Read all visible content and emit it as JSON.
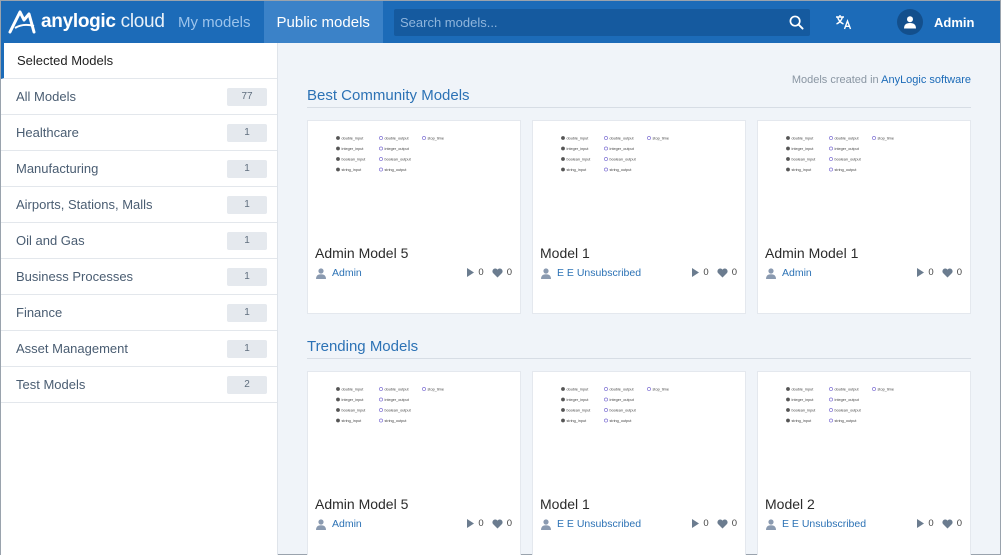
{
  "header": {
    "logo_bold": "anylogic",
    "logo_light": " cloud",
    "nav": [
      {
        "label": "My models",
        "active": false
      },
      {
        "label": "Public models",
        "active": true
      }
    ],
    "search": {
      "placeholder": "Search models..."
    },
    "user": {
      "name": "Admin"
    }
  },
  "sidebar": {
    "items": [
      {
        "label": "Selected Models",
        "count": null,
        "selected": true
      },
      {
        "label": "All Models",
        "count": "77"
      },
      {
        "label": "Healthcare",
        "count": "1"
      },
      {
        "label": "Manufacturing",
        "count": "1"
      },
      {
        "label": "Airports, Stations, Malls",
        "count": "1"
      },
      {
        "label": "Oil and Gas",
        "count": "1"
      },
      {
        "label": "Business Processes",
        "count": "1"
      },
      {
        "label": "Finance",
        "count": "1"
      },
      {
        "label": "Asset Management",
        "count": "1"
      },
      {
        "label": "Test Models",
        "count": "2"
      }
    ]
  },
  "main": {
    "note_prefix": "Models created in ",
    "note_link": "AnyLogic software",
    "sections": [
      {
        "title": "Best Community Models",
        "cards": [
          {
            "title": "Admin Model 5",
            "author": "Admin",
            "runs": "0",
            "likes": "0"
          },
          {
            "title": "Model 1",
            "author": "E E Unsubscribed",
            "runs": "0",
            "likes": "0"
          },
          {
            "title": "Admin Model 1",
            "author": "Admin",
            "runs": "0",
            "likes": "0"
          }
        ]
      },
      {
        "title": "Trending Models",
        "cards": [
          {
            "title": "Admin Model 5",
            "author": "Admin",
            "runs": "0",
            "likes": "0"
          },
          {
            "title": "Model 1",
            "author": "E E Unsubscribed",
            "runs": "0",
            "likes": "0"
          },
          {
            "title": "Model 2",
            "author": "E E Unsubscribed",
            "runs": "0",
            "likes": "0"
          }
        ]
      }
    ],
    "thumbnail_labels": {
      "col1": [
        "double_input",
        "integer_input",
        "boolean_input",
        "string_input"
      ],
      "col2": [
        "double_output",
        "integer_output",
        "boolean_output",
        "string_output"
      ],
      "col3": [
        "stop_time"
      ]
    }
  },
  "colors": {
    "header_bg": "#1c6bb8",
    "active_nav_bg": "#3b82c8",
    "link": "#2c72b5",
    "page_bg": "#f0f4f9"
  }
}
